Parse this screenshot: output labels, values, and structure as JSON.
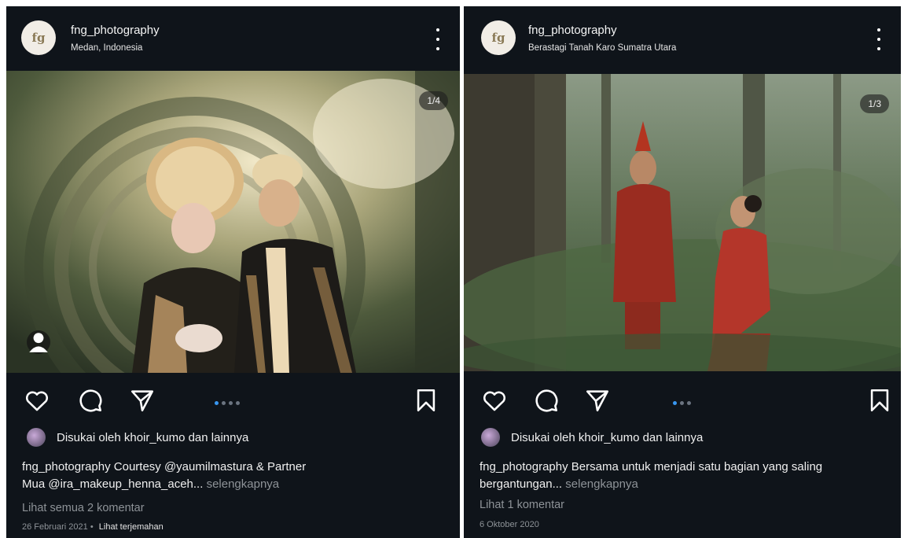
{
  "posts": [
    {
      "avatar_text": "fg",
      "username": "fng_photography",
      "location": "Medan, Indonesia",
      "counter": "1/4",
      "dots_total": 4,
      "dots_active": 1,
      "likes_text": "Disukai oleh khoir_kumo dan lainnya",
      "caption_line1": "fng_photography Courtesy @yaumilmastura & Partner",
      "caption_line2": "Mua @ira_makeup_henna_aceh...",
      "caption_more": "selengkapnya",
      "comments_link": "Lihat semua 2 komentar",
      "date": "26 Februari 2021",
      "separator": "•",
      "translate": "Lihat terjemahan",
      "icons": [
        "heart-icon",
        "comment-icon",
        "share-icon",
        "bookmark-icon",
        "more-vertical-icon",
        "person-tag-icon"
      ]
    },
    {
      "avatar_text": "fg",
      "username": "fng_photography",
      "location": "Berastagi Tanah Karo Sumatra Utara",
      "counter": "1/3",
      "dots_total": 3,
      "dots_active": 1,
      "likes_text": "Disukai oleh khoir_kumo dan lainnya",
      "caption_line1": "fng_photography Bersama untuk menjadi satu bagian yang saling",
      "caption_line2": "bergantungan...",
      "caption_more": "selengkapnya",
      "comments_link": "Lihat 1 komentar",
      "date": "6 Oktober 2020",
      "icons": [
        "heart-icon",
        "comment-icon",
        "share-icon",
        "bookmark-icon",
        "more-vertical-icon"
      ]
    }
  ],
  "colors": {
    "background": "#0f141a",
    "text": "#f0f0f0",
    "muted": "#8e9398",
    "active_dot": "#3897f0",
    "inactive_dot": "#6b7480"
  }
}
